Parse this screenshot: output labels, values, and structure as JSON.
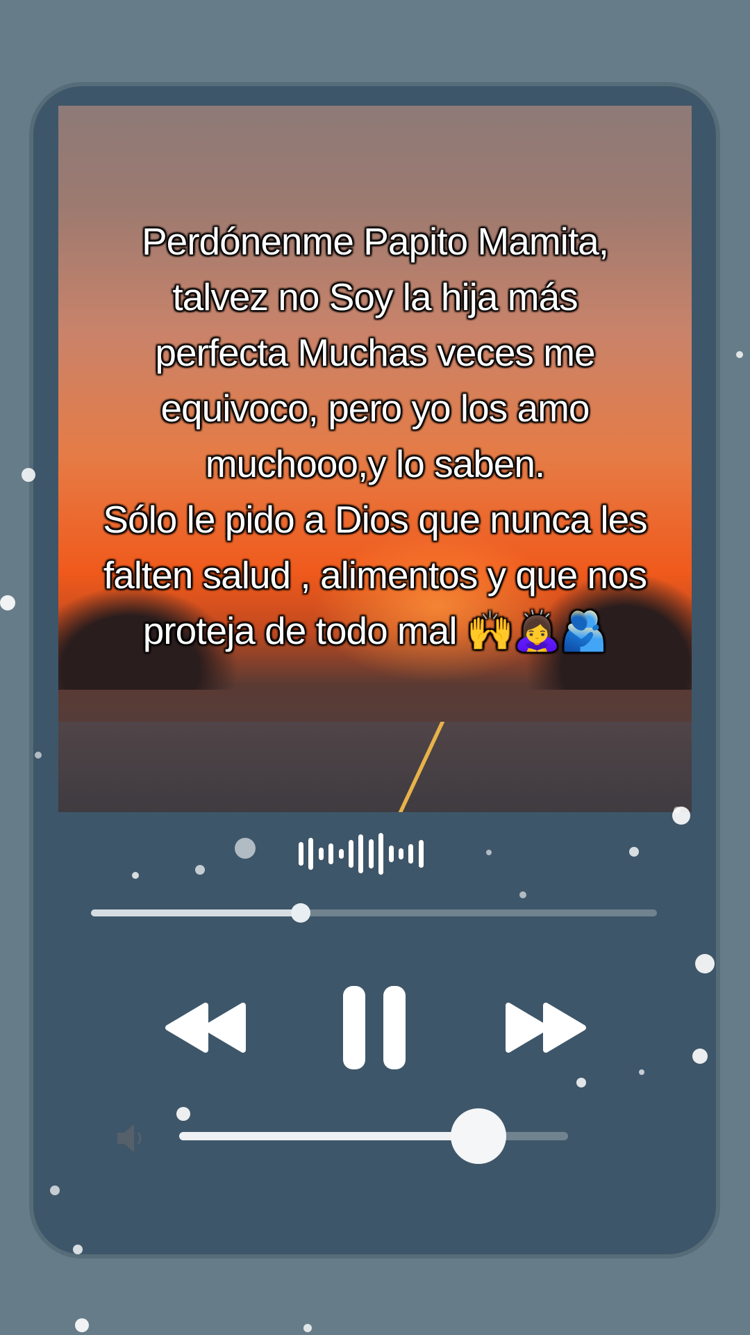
{
  "artwork": {
    "quote_lines": [
      "Perdónenme Papito Mamita,",
      "talvez no Soy la hija más",
      "perfecta Muchas veces me",
      "equivoco, pero yo los amo",
      "muchooo,y lo saben.",
      "Sólo le pido a Dios que nunca les",
      "falten salud , alimentos y que nos",
      "proteja de todo mal 🙌🙇‍♀️🫂"
    ]
  },
  "player": {
    "waveform_icon": "audio-waveform-icon",
    "progress": 0.37,
    "volume": 0.77,
    "controls": {
      "rewind_icon": "rewind-icon",
      "pause_icon": "pause-icon",
      "forward_icon": "fast-forward-icon",
      "speaker_icon": "speaker-icon"
    }
  },
  "colors": {
    "background": "#667c89",
    "card": "#3e5669",
    "accent": "#ffffff"
  }
}
